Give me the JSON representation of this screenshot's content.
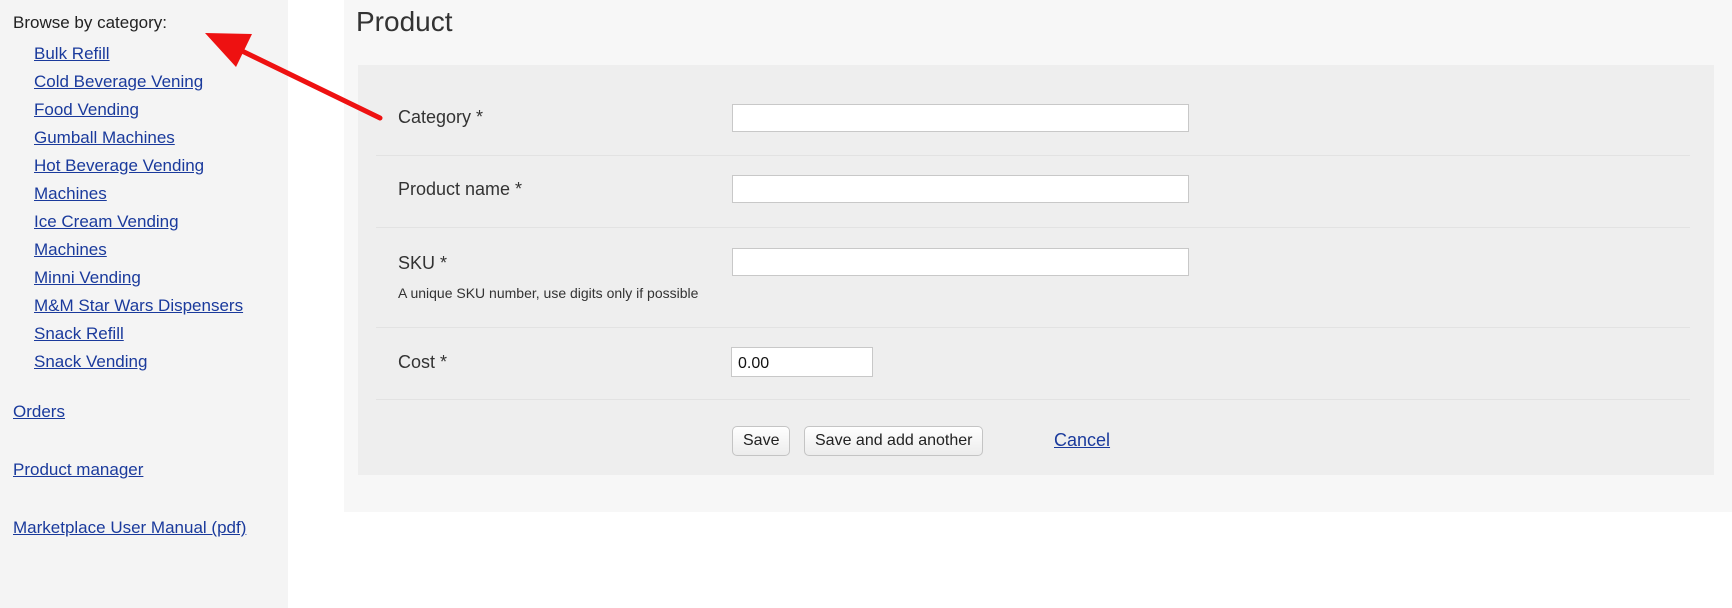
{
  "sidebar": {
    "browse_label": "Browse by category:",
    "categories": [
      "Bulk Refill",
      "Cold Beverage Vening",
      "Food Vending",
      "Gumball Machines",
      "Hot Beverage Vending",
      "Machines",
      "Ice Cream Vending",
      "Machines",
      "Minni Vending",
      "M&M Star Wars Dispensers",
      "Snack Refill",
      "Snack Vending"
    ],
    "orders_link": "Orders",
    "product_manager_link": "Product manager",
    "manual_link": "Marketplace User Manual (pdf)"
  },
  "main": {
    "title": "Product",
    "form": {
      "category": {
        "label": "Category *",
        "value": ""
      },
      "product_name": {
        "label": "Product name *",
        "value": ""
      },
      "sku": {
        "label": "SKU *",
        "value": "",
        "help": "A unique SKU number, use digits only if possible"
      },
      "cost": {
        "label": "Cost *",
        "value": "0.00"
      }
    },
    "actions": {
      "save_label": "Save",
      "save_add_label": "Save and add another",
      "cancel_label": "Cancel"
    }
  },
  "colors": {
    "link": "#1a3a9c",
    "annotation_arrow": "#ee1111",
    "sidebar_bg": "#f4f4f4",
    "panel_bg": "#eeeeee"
  },
  "icons": {
    "annotation": "red-arrow-icon"
  }
}
